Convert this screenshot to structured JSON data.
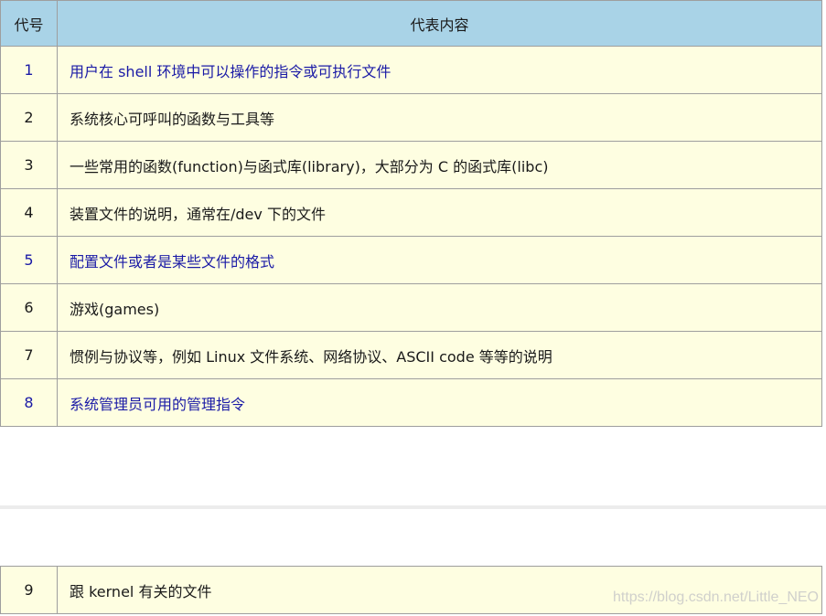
{
  "header": {
    "code": "代号",
    "meaning": "代表内容"
  },
  "rows": [
    {
      "code": "1",
      "text": "用户在 shell 环境中可以操作的指令或可执行文件"
    },
    {
      "code": "2",
      "text": "系统核心可呼叫的函数与工具等"
    },
    {
      "code": "3",
      "text": "一些常用的函数(function)与函式库(library)，大部分为 C 的函式库(libc)"
    },
    {
      "code": "4",
      "text": "装置文件的说明，通常在/dev 下的文件"
    },
    {
      "code": "5",
      "text": "配置文件或者是某些文件的格式"
    },
    {
      "code": "6",
      "text": "游戏(games)"
    },
    {
      "code": "7",
      "text": "惯例与协议等，例如 Linux 文件系统、网络协议、ASCII code 等等的说明"
    },
    {
      "code": "8",
      "text": "系统管理员可用的管理指令"
    }
  ],
  "row9": {
    "code": "9",
    "text": "跟 kernel 有关的文件"
  },
  "watermark": "https://blog.csdn.net/Little_NEO"
}
